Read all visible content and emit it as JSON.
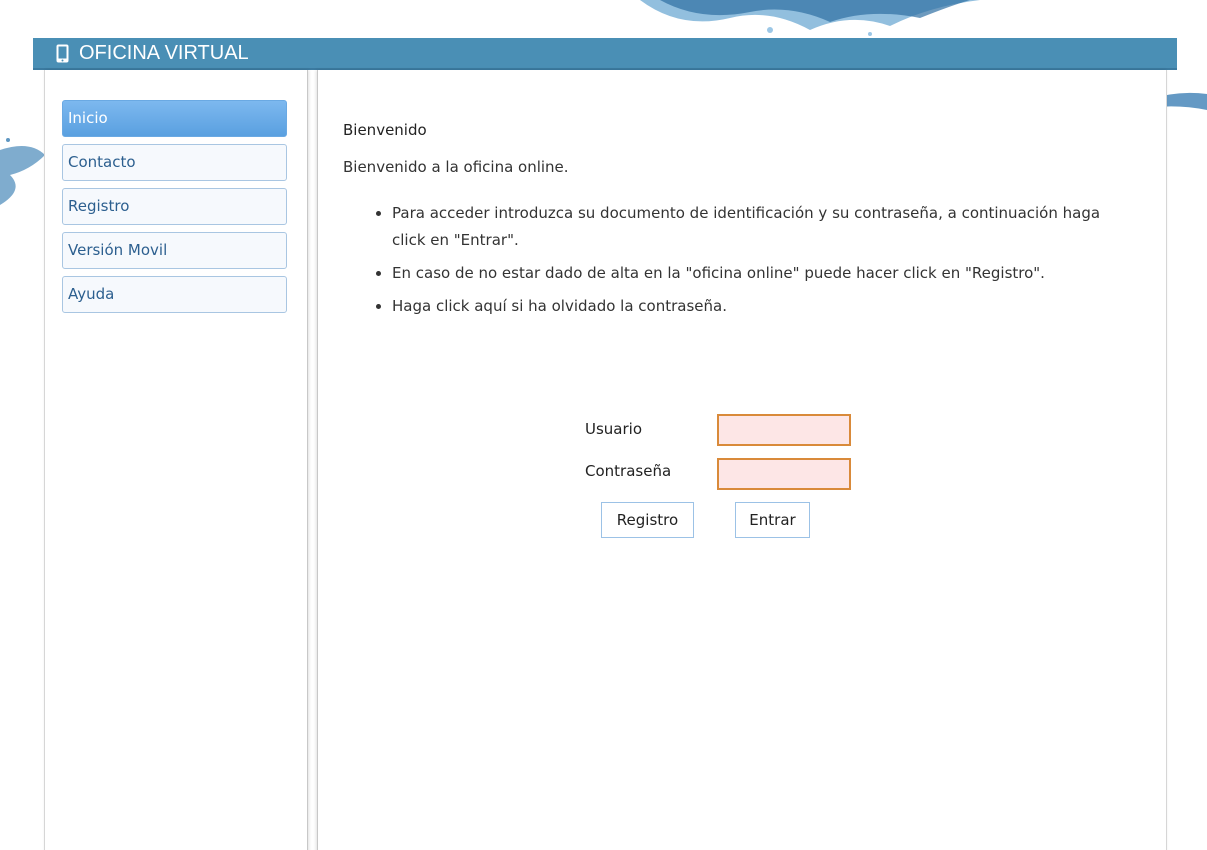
{
  "header": {
    "title": "OFICINA VIRTUAL",
    "icon": "mobile-phone-icon",
    "color": "#4a8fb5"
  },
  "sidebar": {
    "items": [
      {
        "label": "Inicio",
        "active": true
      },
      {
        "label": "Contacto",
        "active": false
      },
      {
        "label": "Registro",
        "active": false
      },
      {
        "label": "Versión Movil",
        "active": false
      },
      {
        "label": "Ayuda",
        "active": false
      }
    ]
  },
  "main": {
    "heading": "Bienvenido",
    "intro": "Bienvenido a la oficina online.",
    "bullets": [
      "Para acceder introduzca su documento de identificación y su contraseña, a continuación haga click en \"Entrar\".",
      "En caso de no estar dado de alta en la \"oficina online\" puede hacer click en \"Registro\".",
      "Haga click aquí si ha olvidado la contraseña."
    ]
  },
  "login": {
    "username_label": "Usuario",
    "username_value": "",
    "password_label": "Contraseña",
    "password_value": "",
    "register_button": "Registro",
    "submit_button": "Entrar"
  },
  "colors": {
    "input_background": "#fde6e6",
    "input_border": "#d98a3a",
    "nav_active": "#6aa9e3"
  }
}
